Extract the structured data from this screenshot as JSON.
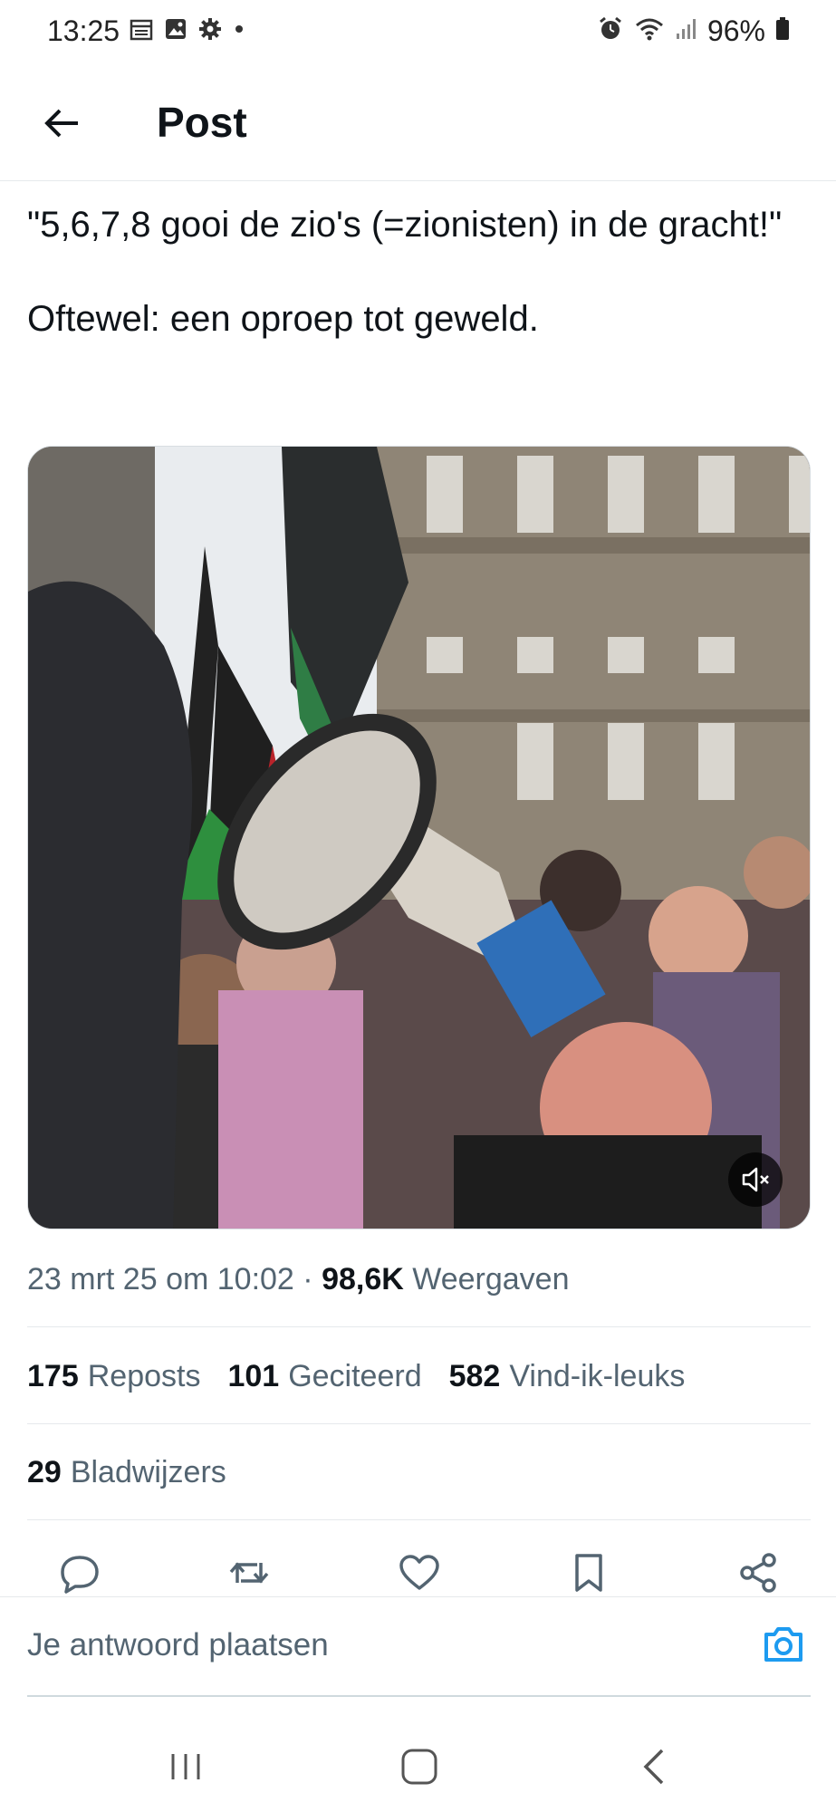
{
  "status_bar": {
    "time": "13:25",
    "battery": "96%",
    "left_icons": [
      "calendar-icon",
      "gallery-icon",
      "settings-gear-icon",
      "dot-icon"
    ],
    "right_icons": [
      "alarm-icon",
      "wifi-icon",
      "signal-icon",
      "battery-icon"
    ]
  },
  "header": {
    "title": "Post",
    "back_icon": "arrow-left-icon"
  },
  "post": {
    "line1": "\"5,6,7,8 gooi de zio's (=zionisten) in de gracht!\"",
    "line2": "Oftewel: een oproep tot geweld."
  },
  "media": {
    "type": "video",
    "muted": true,
    "mute_icon": "speaker-mute-icon"
  },
  "meta": {
    "timestamp": "23 mrt 25 om 10:02",
    "separator": "·",
    "views_count": "98,6K",
    "views_label": "Weergaven"
  },
  "stats": {
    "reposts_count": "175",
    "reposts_label": "Reposts",
    "quotes_count": "101",
    "quotes_label": "Geciteerd",
    "likes_count": "582",
    "likes_label": "Vind-ik-leuks",
    "bookmarks_count": "29",
    "bookmarks_label": "Bladwijzers"
  },
  "actions": [
    "reply-icon",
    "repost-icon",
    "like-heart-icon",
    "bookmark-icon",
    "share-icon"
  ],
  "reply": {
    "placeholder": "Je antwoord plaatsen",
    "camera_icon": "camera-icon"
  },
  "nav": [
    "recents-icon",
    "home-icon",
    "back-chevron-icon"
  ],
  "colors": {
    "text": "#0f1419",
    "secondary": "#536471",
    "accent": "#1d9bf0",
    "divider": "#e6e9ec"
  }
}
